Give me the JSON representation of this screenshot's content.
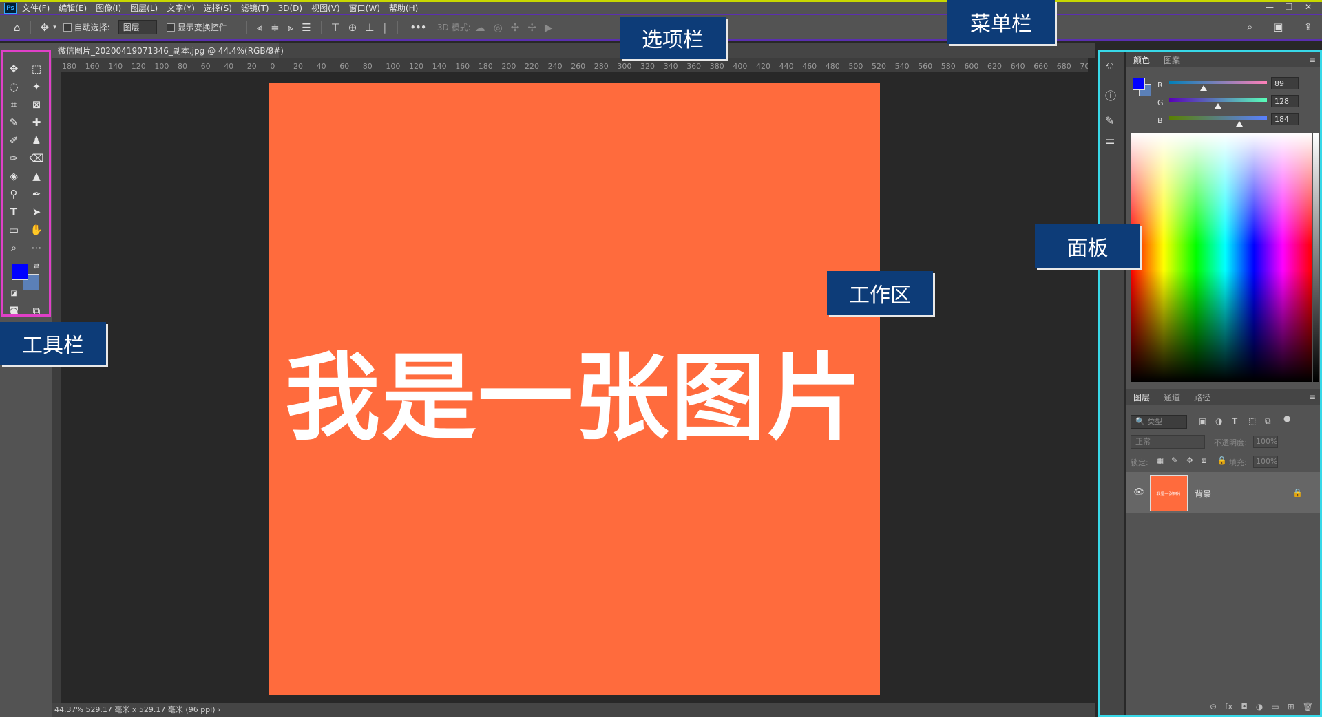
{
  "menubar": {
    "logo": "Ps",
    "items": [
      "文件(F)",
      "编辑(E)",
      "图像(I)",
      "图层(L)",
      "文字(Y)",
      "选择(S)",
      "滤镜(T)",
      "3D(D)",
      "视图(V)",
      "窗口(W)",
      "帮助(H)"
    ],
    "window_controls": [
      "—",
      "❐",
      "✕"
    ]
  },
  "options": {
    "auto_select_label": "自动选择:",
    "auto_select_value": "图层",
    "show_transform_label": "显示变换控件",
    "more_label": "•••",
    "mode_3d_label": "3D 模式:"
  },
  "document": {
    "tab_title": "微信图片_20200419071346_副本.jpg @ 44.4%(RGB/8#)",
    "tab_close": "×",
    "image_text": "我是一张图片",
    "status": "44.37%   529.17 毫米 x 529.17 毫米 (96 ppi)   ›"
  },
  "ruler_top": [
    "180",
    "160",
    "140",
    "120",
    "100",
    "80",
    "60",
    "40",
    "20",
    "0",
    "20",
    "40",
    "60",
    "80",
    "100",
    "120",
    "140",
    "160",
    "180",
    "200",
    "220",
    "240",
    "260",
    "280",
    "300",
    "320",
    "340",
    "360",
    "380",
    "400",
    "420",
    "440",
    "460",
    "480",
    "500",
    "520",
    "540",
    "560",
    "580",
    "600",
    "620",
    "640",
    "660",
    "680",
    "70"
  ],
  "color_panel": {
    "tabs": [
      "颜色",
      "图案"
    ],
    "channels": [
      {
        "label": "R",
        "value": "89",
        "fraction": 0.35
      },
      {
        "label": "G",
        "value": "128",
        "fraction": 0.5
      },
      {
        "label": "B",
        "value": "184",
        "fraction": 0.72
      }
    ]
  },
  "layers_panel": {
    "tabs": [
      "图层",
      "通道",
      "路径"
    ],
    "filter_placeholder": "🔍 类型",
    "blend_mode": "正常",
    "opacity_label": "不透明度:",
    "opacity_value": "100%",
    "lock_label": "锁定:",
    "fill_label": "填充:",
    "fill_value": "100%",
    "layers": [
      {
        "name": "背景",
        "thumb_text": "我是一张图片"
      }
    ],
    "footer_icons": [
      "⊝",
      "fx",
      "◘",
      "◑",
      "▭",
      "⊞",
      "🗑"
    ]
  },
  "callouts": {
    "menubar": "菜单栏",
    "options": "选项栏",
    "toolbar": "工具栏",
    "workspace": "工作区",
    "panels": "面板"
  },
  "colors": {
    "image_bg": "#ff6b3d",
    "foreground": "#0000ff",
    "background": "#5b80b8",
    "callout_bg": "#0d3c78"
  }
}
